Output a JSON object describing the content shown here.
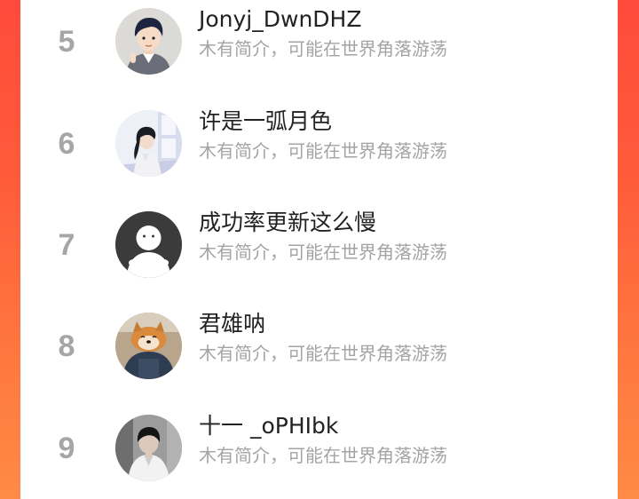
{
  "colors": {
    "background_gradient_top": "#ff4a3b",
    "background_gradient_bottom": "#ff8a46",
    "card": "#ffffff",
    "rank_text": "#a6a6a6",
    "name_text": "#222222",
    "bio_text": "#a4a4a4"
  },
  "leaderboard": {
    "entries": [
      {
        "rank": "5",
        "name": "Jonyj_DwnDHZ",
        "bio": "木有简介，可能在世界角落游荡",
        "avatar_icon": "cartoon-boy-avatar-icon"
      },
      {
        "rank": "6",
        "name": "许是一弧月色",
        "bio": "木有简介，可能在世界角落游荡",
        "avatar_icon": "illustrated-girl-avatar-icon"
      },
      {
        "rank": "7",
        "name": "成功率更新这么慢",
        "bio": "木有简介，可能在世界角落游荡",
        "avatar_icon": "default-user-avatar-icon"
      },
      {
        "rank": "8",
        "name": "君雄呐",
        "bio": "木有简介，可能在世界角落游荡",
        "avatar_icon": "shiba-dog-avatar-icon"
      },
      {
        "rank": "9",
        "name": "十一 _oPHIbk",
        "bio": "木有简介，可能在世界角落游荡",
        "avatar_icon": "person-photo-avatar-icon"
      }
    ]
  }
}
